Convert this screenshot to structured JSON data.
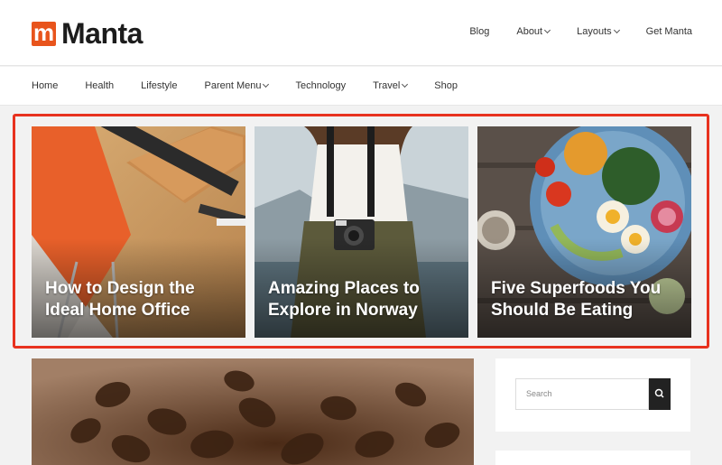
{
  "header": {
    "logo_letter": "m",
    "logo_text": "Manta",
    "brand_color": "#e8541c",
    "top_nav": [
      {
        "label": "Blog",
        "has_dropdown": false
      },
      {
        "label": "About",
        "has_dropdown": true
      },
      {
        "label": "Layouts",
        "has_dropdown": true
      },
      {
        "label": "Get Manta",
        "has_dropdown": false
      }
    ]
  },
  "main_nav": [
    {
      "label": "Home",
      "has_dropdown": false
    },
    {
      "label": "Health",
      "has_dropdown": false
    },
    {
      "label": "Lifestyle",
      "has_dropdown": false
    },
    {
      "label": "Parent Menu",
      "has_dropdown": true
    },
    {
      "label": "Technology",
      "has_dropdown": false
    },
    {
      "label": "Travel",
      "has_dropdown": true
    },
    {
      "label": "Shop",
      "has_dropdown": false
    }
  ],
  "featured": {
    "highlight_color": "#e8321f",
    "posts": [
      {
        "title": "How to Design the Ideal Home Office"
      },
      {
        "title": "Amazing Places to Explore in Norway"
      },
      {
        "title": "Five Superfoods You Should Be Eating"
      }
    ]
  },
  "sidebar": {
    "search_placeholder": "Search",
    "search_icon": "search-icon"
  }
}
